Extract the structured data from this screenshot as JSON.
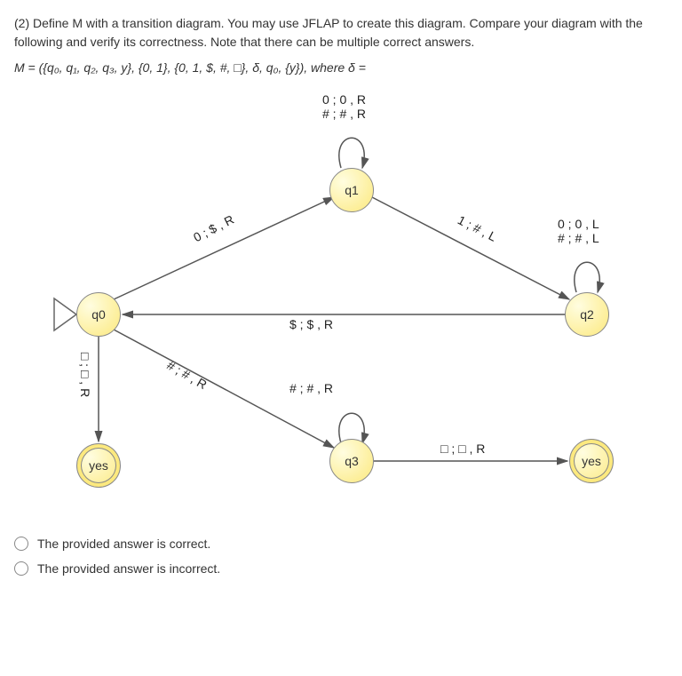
{
  "question": {
    "part1": "(2) Define M with a transition diagram. You may use JFLAP to create this diagram.  Compare your diagram with the following and verify its correctness. Note that there can be multiple correct answers.",
    "formula": "M = ({q₀, q₁, q₂, q₃, y}, {0, 1}, {0, 1, $, #, □}, δ, q₀, {y}), where δ ="
  },
  "states": {
    "q0": "q0",
    "q1": "q1",
    "q2": "q2",
    "q3": "q3",
    "yes1": "yes",
    "yes2": "yes"
  },
  "labels": {
    "q1_loop": "0 ; 0 , R\n# ; # , R",
    "q2_loop": "0 ; 0 , L\n# ; # , L",
    "q3_loop": "# ; # , R",
    "q0_q1": "0 ; $ , R",
    "q1_q2": "1 ; # , L",
    "q2_q0": "$ ; $ , R",
    "q0_q3": "# ; # , R",
    "q0_yes1": "□ ; □ , R",
    "q3_yes2": "□ ; □ , R"
  },
  "options": {
    "opt1": "The provided answer is correct.",
    "opt2": "The provided answer is incorrect."
  }
}
